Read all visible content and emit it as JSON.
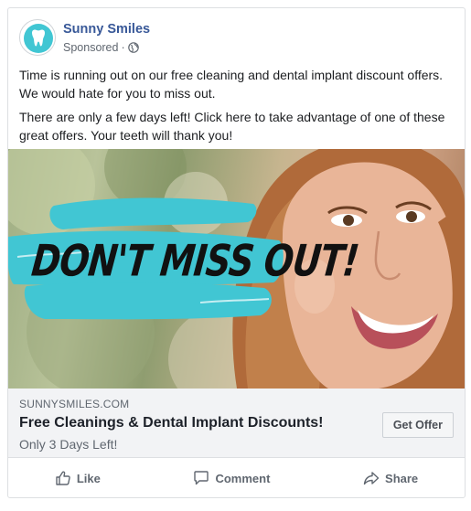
{
  "post": {
    "page_name": "Sunny Smiles",
    "sponsored_label": "Sponsored",
    "separator": "·",
    "privacy_icon": "globe-icon",
    "avatar_icon": "tooth-icon",
    "paragraphs": [
      "Time is running out on our free cleaning and dental implant discount offers. We would hate for you to miss out.",
      "There are only a few days left! Click here to take advantage of one of these great offers. Your teeth will thank you!"
    ]
  },
  "hero": {
    "overlay_text": "DON'T MISS OUT!",
    "brush_color": "#41c6d3"
  },
  "link_preview": {
    "domain": "SUNNYSMILES.COM",
    "headline": "Free Cleanings & Dental Implant Discounts!",
    "subline": "Only 3 Days Left!",
    "cta_label": "Get Offer"
  },
  "actions": {
    "like": {
      "label": "Like",
      "icon": "thumbs-up-icon"
    },
    "comment": {
      "label": "Comment",
      "icon": "comment-icon"
    },
    "share": {
      "label": "Share",
      "icon": "share-arrow-icon"
    }
  },
  "colors": {
    "link_blue": "#385898",
    "secondary_text": "#606770",
    "teal": "#41c6d3"
  }
}
